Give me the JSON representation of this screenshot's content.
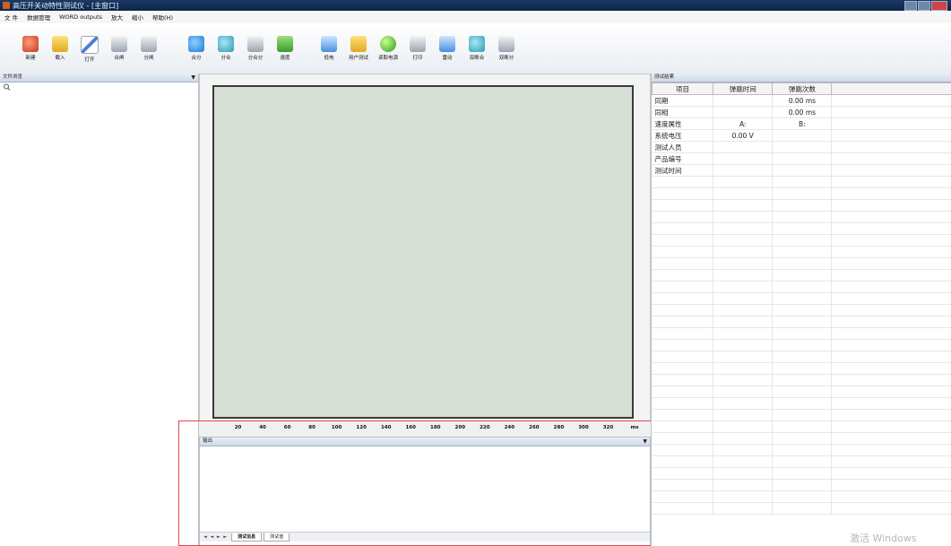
{
  "window": {
    "title": "高压开关动特性测试仪 - [主窗口]"
  },
  "menu": [
    "文 件",
    "数据管理",
    "WORD   outputs",
    "放大",
    "缩小",
    "帮助(H)"
  ],
  "toolbar": [
    {
      "label": "新建",
      "icon": "new-icon",
      "style": "red"
    },
    {
      "label": "载入",
      "icon": "folder-icon",
      "style": "folder"
    },
    {
      "label": "打开",
      "icon": "pen-icon",
      "style": "pen"
    },
    {
      "label": "合闸",
      "icon": "close-switch-icon",
      "style": "box"
    },
    {
      "label": "分闸",
      "icon": "open-switch-icon",
      "style": "box"
    },
    {
      "label": "合分",
      "icon": "close-open-icon",
      "style": "blue"
    },
    {
      "label": "分合",
      "icon": "open-close-icon",
      "style": "teal"
    },
    {
      "label": "分合分",
      "icon": "open-close-open-icon",
      "style": "box"
    },
    {
      "label": "速度",
      "icon": "speed-icon",
      "style": "green"
    },
    {
      "label": "低电",
      "icon": "low-voltage-icon",
      "style": "dl"
    },
    {
      "label": "用户测试",
      "icon": "user-test-icon",
      "style": "folder"
    },
    {
      "label": "读取电源",
      "icon": "power-globe-icon",
      "style": "globe"
    },
    {
      "label": "打印",
      "icon": "print-icon",
      "style": "box"
    },
    {
      "label": "雷动",
      "icon": "thunder-icon",
      "style": "dl"
    },
    {
      "label": "双断合",
      "icon": "double-close-icon",
      "style": "teal"
    },
    {
      "label": "双断分",
      "icon": "double-open-icon",
      "style": "box"
    }
  ],
  "left_panel": {
    "title": "文件浏览",
    "arrow": "▼"
  },
  "chart_data": {
    "type": "line",
    "x_ticks": [
      20,
      40,
      60,
      80,
      100,
      120,
      140,
      160,
      180,
      200,
      220,
      240,
      260,
      280,
      300,
      320
    ],
    "x_unit": "ms",
    "xlim": [
      0,
      340
    ]
  },
  "output_panel": {
    "title": "输出",
    "arrow": "▼",
    "nav": "◄ ◄ ► ►",
    "tabs": [
      "测试信息",
      "测试值"
    ]
  },
  "results": {
    "panel_title": "测试结果",
    "headers": [
      "项目",
      "弹跳时间",
      "弹跳次数"
    ],
    "rows": [
      [
        "同期",
        "",
        "0.00 ms"
      ],
      [
        "同相",
        "",
        "0.00 ms"
      ],
      [
        "速度属性",
        "A:",
        "B:"
      ],
      [
        "系统电压",
        "0.00 V",
        ""
      ],
      [
        "测试人员",
        "",
        ""
      ],
      [
        "产品编号",
        "",
        ""
      ],
      [
        "测试时间",
        "",
        ""
      ],
      [
        "",
        "",
        ""
      ],
      [
        "",
        "",
        ""
      ],
      [
        "",
        "",
        ""
      ],
      [
        "",
        "",
        ""
      ],
      [
        "",
        "",
        ""
      ],
      [
        "",
        "",
        ""
      ],
      [
        "",
        "",
        ""
      ],
      [
        "",
        "",
        ""
      ],
      [
        "",
        "",
        ""
      ],
      [
        "",
        "",
        ""
      ],
      [
        "",
        "",
        ""
      ],
      [
        "",
        "",
        ""
      ],
      [
        "",
        "",
        ""
      ],
      [
        "",
        "",
        ""
      ],
      [
        "",
        "",
        ""
      ],
      [
        "",
        "",
        ""
      ],
      [
        "",
        "",
        ""
      ],
      [
        "",
        "",
        ""
      ],
      [
        "",
        "",
        ""
      ],
      [
        "",
        "",
        ""
      ],
      [
        "",
        "",
        ""
      ],
      [
        "",
        "",
        ""
      ],
      [
        "",
        "",
        ""
      ],
      [
        "",
        "",
        ""
      ],
      [
        "",
        "",
        ""
      ],
      [
        "",
        "",
        ""
      ],
      [
        "",
        "",
        ""
      ],
      [
        "",
        "",
        ""
      ],
      [
        "",
        "",
        ""
      ]
    ]
  },
  "activation_watermark": "激活 Windows"
}
